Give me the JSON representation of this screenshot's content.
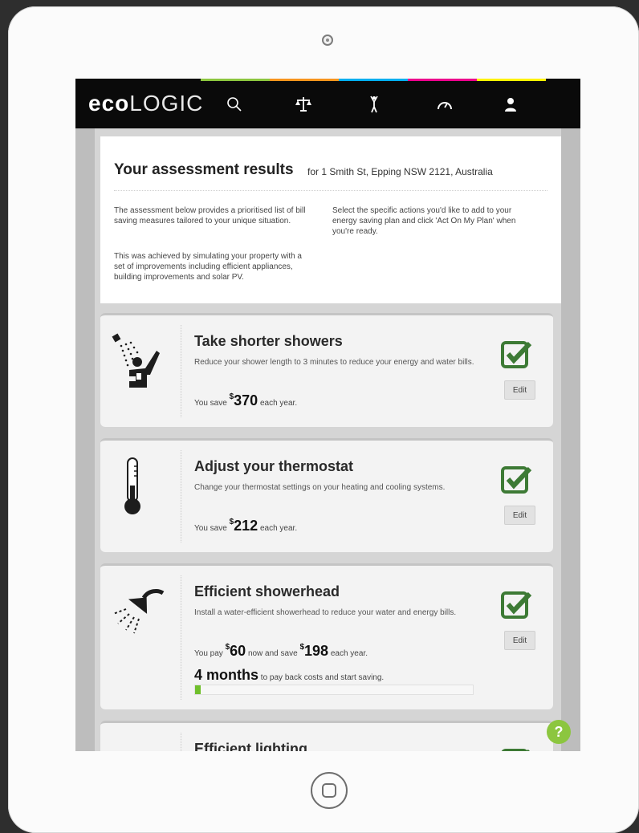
{
  "app": {
    "logo_bold": "eco",
    "logo_light": "LOGIC",
    "nav_stripe_colors": [
      "#8cc63f",
      "#f7941d",
      "#00aeef",
      "#ec008c",
      "#fff200"
    ],
    "nav_icons": [
      "search-icon",
      "scale-icon",
      "person-icon",
      "gauge-icon",
      "user-icon"
    ]
  },
  "intro": {
    "title": "Your assessment results",
    "address": "for 1 Smith St, Epping NSW 2121, Australia",
    "para1": "The assessment below provides a prioritised list of bill saving measures tailored to your unique situation.",
    "para2": "This was achieved by simulating your property with a set of improvements including efficient appliances, building improvements and solar PV.",
    "para3": "Select the specific actions you'd like to add to your energy saving plan and click 'Act On My Plan' when you're ready."
  },
  "cards": [
    {
      "title": "Take shorter showers",
      "desc": "Reduce your shower length to 3 minutes to reduce your energy and water bills.",
      "save_prefix": "You save",
      "currency": "$",
      "amount": "370",
      "save_suffix": "each year.",
      "edit_label": "Edit",
      "icon": "shower-person-icon",
      "checked": true
    },
    {
      "title": "Adjust your thermostat",
      "desc": "Change your thermostat settings on your heating and cooling systems.",
      "save_prefix": "You save",
      "currency": "$",
      "amount": "212",
      "save_suffix": "each year.",
      "edit_label": "Edit",
      "icon": "thermometer-icon",
      "checked": true
    },
    {
      "title": "Efficient showerhead",
      "desc": "Install a water-efficient showerhead to reduce your water and energy bills.",
      "pay_prefix": "You pay",
      "currency": "$",
      "pay_amount": "60",
      "save_mid": "now and save",
      "amount": "198",
      "save_suffix": "each year.",
      "payback_value": "4 months",
      "payback_suffix": "to pay back costs and start saving.",
      "payback_progress": 0.02,
      "edit_label": "Edit",
      "icon": "showerhead-icon",
      "checked": true
    },
    {
      "title": "Efficient lighting",
      "icon": "lightbulb-icon",
      "checked": true
    }
  ],
  "help": {
    "label": "?"
  },
  "colors": {
    "check_green": "#3d7a35",
    "progress_green": "#6fbf2b",
    "help_green": "#8cc63f"
  }
}
